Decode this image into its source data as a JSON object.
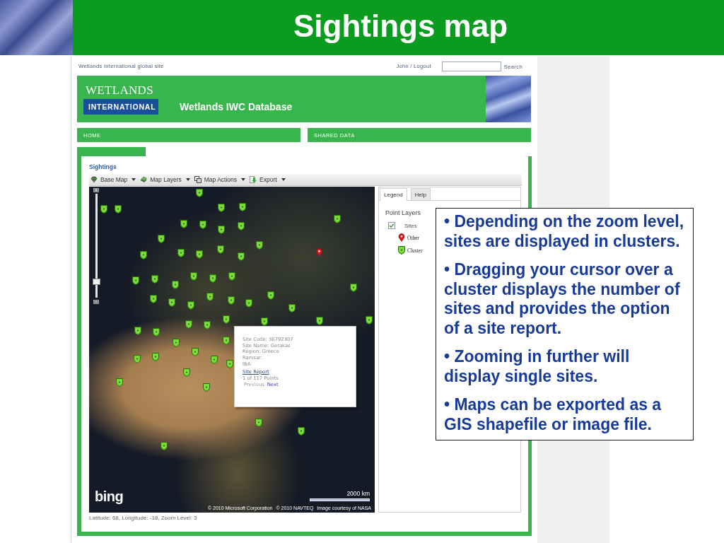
{
  "slide": {
    "title": "Sightings map"
  },
  "site_header": {
    "global_link": "Wetlands International global site",
    "user_link": "John / Logout",
    "search_button": "Search"
  },
  "banner": {
    "logo_top": "WETLANDS",
    "logo_bottom": "INTERNATIONAL",
    "title": "Wetlands IWC Database"
  },
  "nav": [
    {
      "label": "HOME"
    },
    {
      "label": "SHARED DATA"
    }
  ],
  "sightings": {
    "title": "Sightings",
    "toolbar": [
      {
        "label": "Base Map"
      },
      {
        "label": "Map Layers"
      },
      {
        "label": "Map Actions"
      },
      {
        "label": "Export"
      }
    ]
  },
  "map": {
    "zoom_slider": {
      "level": 0.15
    },
    "markers": [
      {
        "kind": "cluster"
      },
      {
        "kind": "cluster"
      },
      {
        "kind": "cluster"
      },
      {
        "kind": "cluster"
      },
      {
        "kind": "cluster"
      },
      {
        "kind": "cluster"
      },
      {
        "kind": "cluster"
      },
      {
        "kind": "cluster"
      },
      {
        "kind": "cluster"
      },
      {
        "kind": "cluster"
      },
      {
        "kind": "cluster"
      },
      {
        "kind": "cluster"
      },
      {
        "kind": "cluster"
      },
      {
        "kind": "cluster"
      },
      {
        "kind": "cluster"
      },
      {
        "kind": "cluster"
      },
      {
        "kind": "cluster"
      },
      {
        "kind": "other"
      },
      {
        "kind": "cluster"
      },
      {
        "kind": "cluster"
      },
      {
        "kind": "cluster"
      },
      {
        "kind": "cluster"
      },
      {
        "kind": "cluster"
      },
      {
        "kind": "cluster"
      },
      {
        "kind": "cluster"
      },
      {
        "kind": "cluster"
      },
      {
        "kind": "cluster"
      },
      {
        "kind": "cluster"
      },
      {
        "kind": "cluster"
      },
      {
        "kind": "cluster"
      },
      {
        "kind": "cluster"
      },
      {
        "kind": "cluster"
      },
      {
        "kind": "cluster"
      },
      {
        "kind": "cluster"
      },
      {
        "kind": "cluster"
      },
      {
        "kind": "cluster"
      },
      {
        "kind": "cluster"
      },
      {
        "kind": "cluster"
      },
      {
        "kind": "cluster"
      },
      {
        "kind": "cluster"
      },
      {
        "kind": "cluster"
      },
      {
        "kind": "cluster"
      },
      {
        "kind": "cluster"
      },
      {
        "kind": "cluster"
      },
      {
        "kind": "cluster"
      },
      {
        "kind": "cluster"
      },
      {
        "kind": "cluster"
      },
      {
        "kind": "cluster"
      },
      {
        "kind": "cluster"
      },
      {
        "kind": "cluster"
      },
      {
        "kind": "cluster"
      },
      {
        "kind": "cluster"
      },
      {
        "kind": "cluster"
      },
      {
        "kind": "cluster"
      }
    ],
    "popup": {
      "lines": [
        "Site Code: 36792307",
        "Site Name: Gerakas",
        "Region: Greece",
        "Ramsar:",
        "IBA:"
      ],
      "link": "Site Report",
      "count": "1 of 117 Points",
      "pager": [
        {
          "label": "Previous",
          "disabled": true
        },
        {
          "label": "Next",
          "disabled": false
        }
      ]
    },
    "logo": "bing",
    "scale": "2000 km",
    "attribution": [
      "© 2010 Microsoft Corporation",
      "© 2010 NAVTEQ",
      "Image courtesy of NASA"
    ]
  },
  "legend": {
    "tabs": [
      {
        "label": "Legend",
        "selected": true
      },
      {
        "label": "Help",
        "selected": false
      }
    ],
    "heading": "Point Layers",
    "layer": {
      "label": "Sites",
      "checked": true
    },
    "symbols": [
      {
        "kind": "other",
        "label": "Other"
      },
      {
        "kind": "cluster",
        "label": "Cluster"
      }
    ]
  },
  "status": "Latitude: 68, Longitude: -18, Zoom Level: 3",
  "callout": {
    "bullets": [
      "• Depending on the zoom level, sites are displayed in clusters.",
      "• Dragging your cursor over a cluster displays the number of sites and provides the option of a site report.",
      "• Zooming in further will display single sites.",
      "• Maps can be exported as a GIS shapefile or image file."
    ]
  }
}
